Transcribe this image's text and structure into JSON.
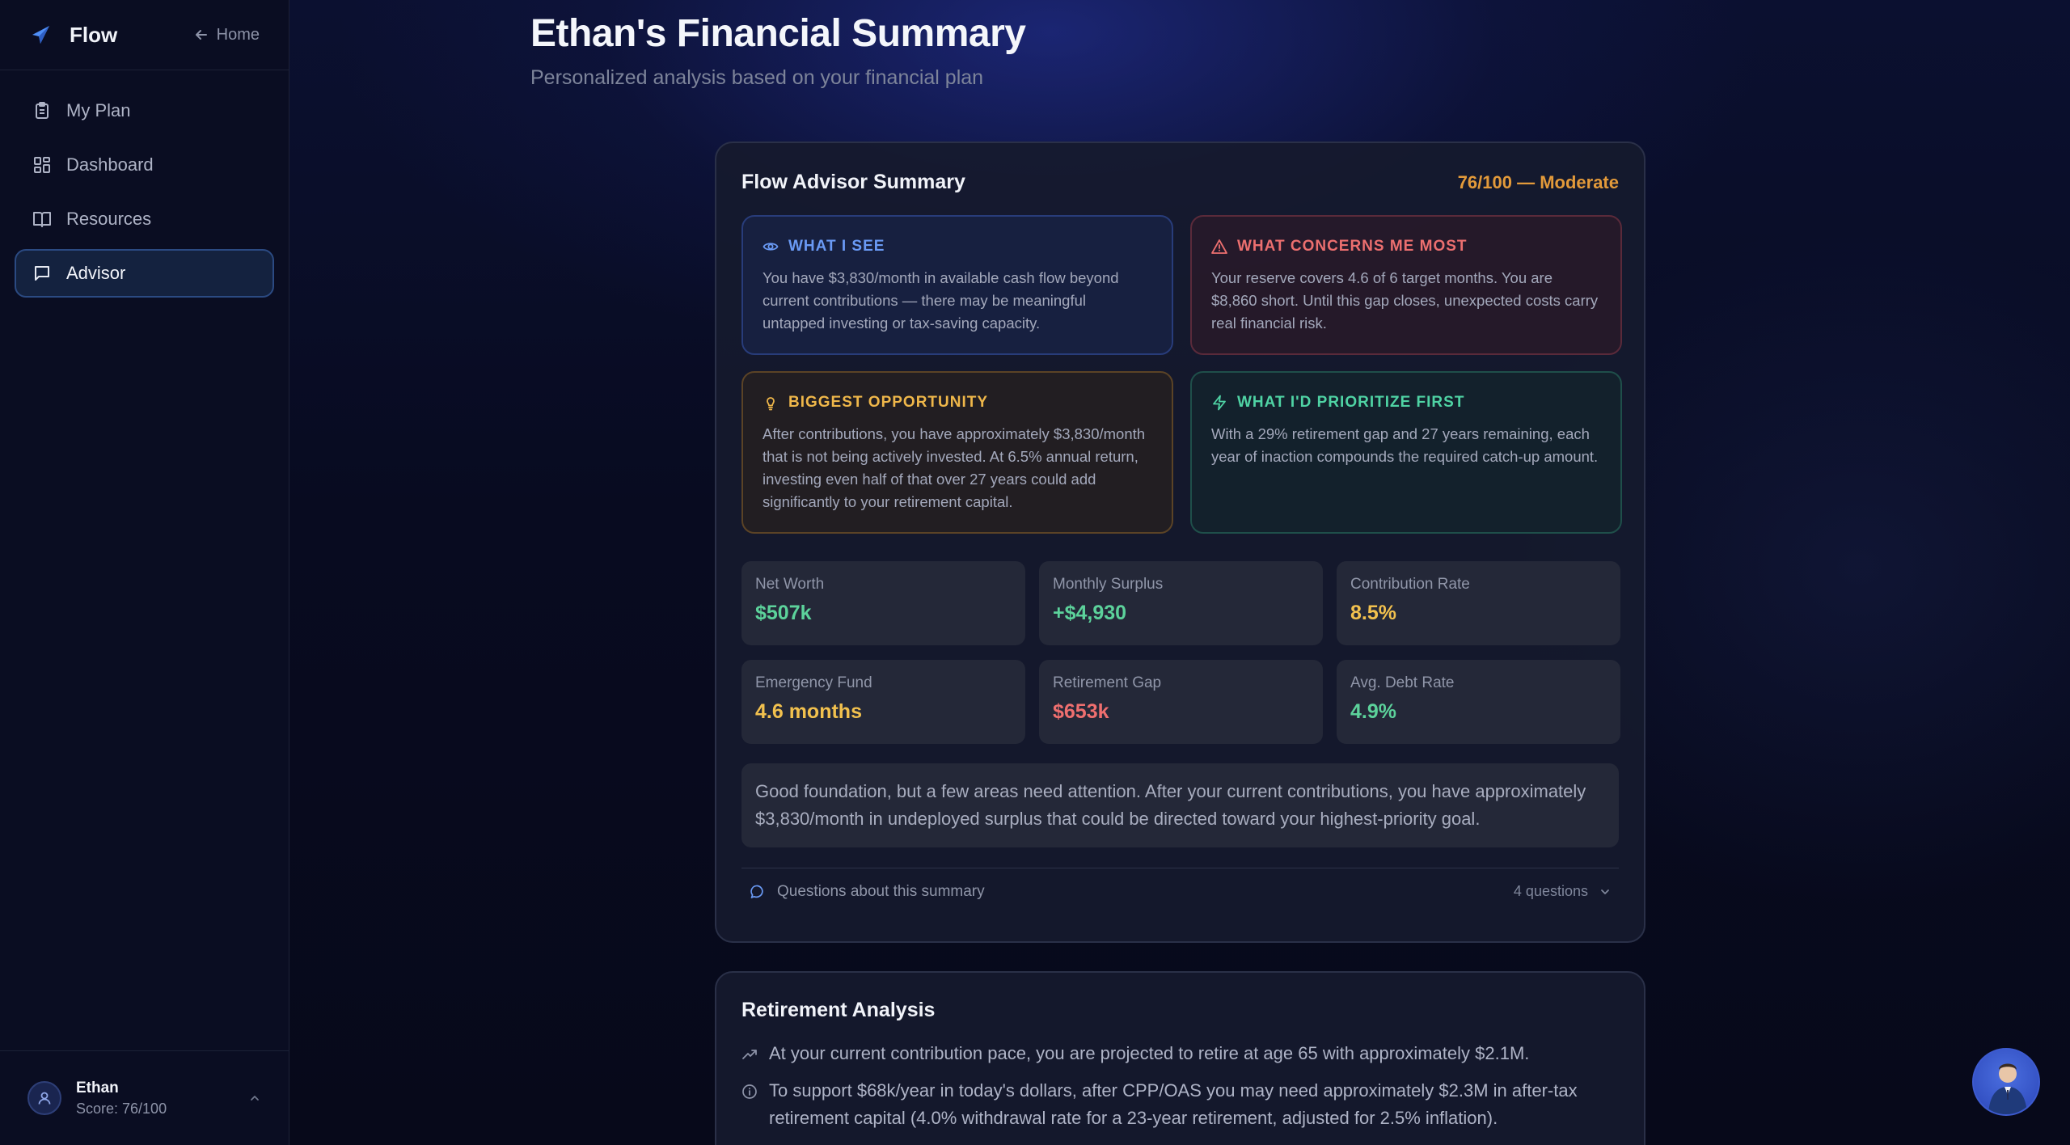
{
  "sidebar": {
    "brand": "Flow",
    "home_label": "Home",
    "items": [
      {
        "label": "My Plan",
        "icon": "clipboard-icon"
      },
      {
        "label": "Dashboard",
        "icon": "grid-icon"
      },
      {
        "label": "Resources",
        "icon": "book-icon"
      },
      {
        "label": "Advisor",
        "icon": "message-icon",
        "active": true
      }
    ],
    "user": {
      "name": "Ethan",
      "score": "Score: 76/100"
    }
  },
  "header": {
    "title": "Ethan's Financial Summary",
    "subtitle": "Personalized analysis based on your financial plan"
  },
  "summary": {
    "title": "Flow Advisor Summary",
    "score": "76/100 — Moderate",
    "insights": [
      {
        "heading": "WHAT I SEE",
        "body": "You have $3,830/month in available cash flow beyond current contributions — there may be meaningful untapped investing or tax-saving capacity.",
        "icon": "eye-icon"
      },
      {
        "heading": "WHAT CONCERNS ME MOST",
        "body": "Your reserve covers 4.6 of 6 target months. You are $8,860 short. Until this gap closes, unexpected costs carry real financial risk.",
        "icon": "warning-icon"
      },
      {
        "heading": "BIGGEST OPPORTUNITY",
        "body": "After contributions, you have approximately $3,830/month that is not being actively invested. At 6.5% annual return, investing even half of that over 27 years could add significantly to your retirement capital.",
        "icon": "lightbulb-icon"
      },
      {
        "heading": "WHAT I'D PRIORITIZE FIRST",
        "body": "With a 29% retirement gap and 27 years remaining, each year of inaction compounds the required catch-up amount.",
        "icon": "lightning-icon"
      }
    ],
    "metrics": [
      {
        "label": "Net Worth",
        "value": "$507k",
        "tone": "green"
      },
      {
        "label": "Monthly Surplus",
        "value": "+$4,930",
        "tone": "green"
      },
      {
        "label": "Contribution Rate",
        "value": "8.5%",
        "tone": "yellow"
      },
      {
        "label": "Emergency Fund",
        "value": "4.6 months",
        "tone": "yellow"
      },
      {
        "label": "Retirement Gap",
        "value": "$653k",
        "tone": "red"
      },
      {
        "label": "Avg. Debt Rate",
        "value": "4.9%",
        "tone": "green"
      }
    ],
    "note": "Good foundation, but a few areas need attention. After your current contributions, you have approximately $3,830/month in undeployed surplus that could be directed toward your highest-priority goal.",
    "questions_label": "Questions about this summary",
    "questions_count": "4 questions"
  },
  "retirement": {
    "title": "Retirement Analysis",
    "lines": [
      {
        "text": "At your current contribution pace, you are projected to retire at age 65 with approximately $2.1M.",
        "icon": "trend-up-icon"
      },
      {
        "text": "To support $68k/year in today's dollars, after CPP/OAS you may need approximately $2.3M in after-tax retirement capital (4.0% withdrawal rate for a 23-year retirement, adjusted for 2.5% inflation).",
        "icon": "info-icon"
      }
    ]
  },
  "colors": {
    "accent": "#2b4a82",
    "positive": "#5cd29b",
    "warning": "#f2c14e",
    "negative": "#ef6f6f",
    "score": "#e39a3a"
  }
}
